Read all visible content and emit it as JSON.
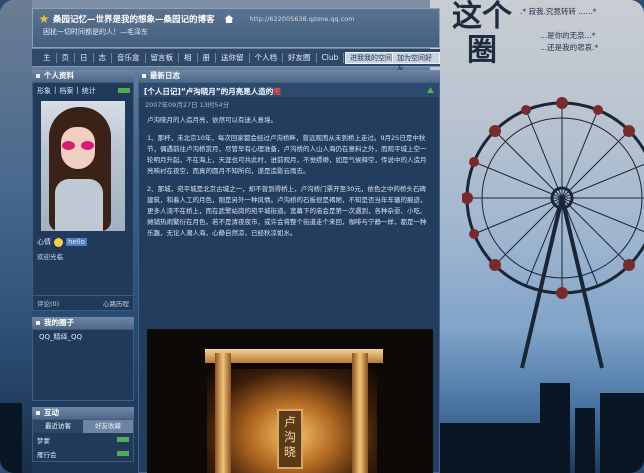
{
  "header": {
    "site_title": "桑园记忆—世界是我的想象—桑园记的博客",
    "site_url": "http://622005638.qzone.qq.com",
    "subtitle": "困扰一切时间都是的人！—毛泽东"
  },
  "nav": {
    "items": [
      "主",
      "页",
      "日",
      "志",
      "音乐盒",
      "留言板",
      "相",
      "册",
      "送你留",
      "个人档",
      "好友圈",
      "Club"
    ],
    "enter_space_button": "进我我的空间",
    "add_favorite_button": "加为空间好友"
  },
  "sidebar": {
    "profile_head": "个人资料",
    "profile_links": [
      "形象",
      "|",
      "档案",
      "|",
      "统计"
    ],
    "mood_label": "心情",
    "mood_badge": "hello",
    "welcome_text": "欢迎光临",
    "comment_label": "评论(0)",
    "history_label": "心路历程",
    "friends_head": "我的圈子",
    "friend_item": "QQ_精绎_QQ",
    "interact_head": "互动",
    "tab_recent": "最近访客",
    "tab_favorites": "好友收藏",
    "mini_rows": [
      "梦蒙",
      "雁行会"
    ]
  },
  "main": {
    "head": "最新日志",
    "post_title_prefix": "[个人日记]“卢沟晓月”的月亮是人造的",
    "post_title_red": "图",
    "post_date": "2007年09月27日 13时54分",
    "paragraphs": [
      "卢沟晓月的人造月亮，依然可以有迷人意境。",
      "1、那杯，未北京10年，每次回家都会经过卢沟桥畔，曾远观而从未到桥上走过。9月25日是中秋节，偶遇前往卢沟桥赏月，尽管早有心理准备，卢沟桥的人山人海仍在意料之外，而观平城上空一轮明月升起，不在海上，天涯也可共此时，进前观月，不觉缥缈，如是气候释空，传说中的人造月亮映衬在夜空，而真的圆月不知所向，遂是造影云雨去。",
      "2、那城，宛平城是北京古城之一，却不曾到得桥上，卢沟桥门票开至30元，依色之中的桥头石碑建筑，和着人工的月色，刚是另外一种风情。卢沟桥的石板很是褐陋，不知是否当年车辙的痕迹，更多人流不在桥上，而在武警站岗的宛平城街道。宽幕下的庙会是第一次遇到，各种杂耍、小吃、摊铺热闹繁衍在月色，若不是清夜夜市，或许会将整个街道走个来回，咖啡与宁静一样，都是一种乐趣，无论人潮人海，心静自然凉，已经秋凉如水。"
    ],
    "photo_caption": "卢沟晓"
  },
  "decor": {
    "big_title": "这个圈",
    "line1": ".* 寂我.究竟转转 ......*",
    "line2": "...是你的无奈...*",
    "line3": "...还是我的悲哀.*"
  }
}
